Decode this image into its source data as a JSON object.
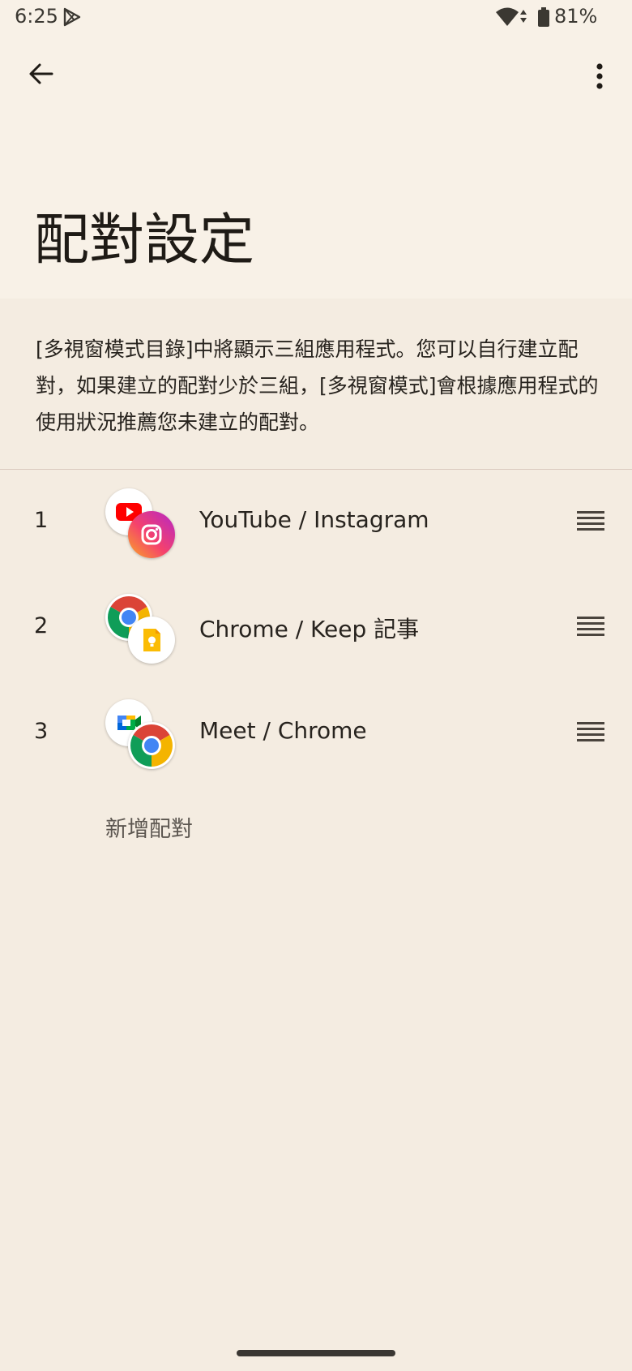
{
  "status": {
    "time": "6:25",
    "battery": "81%"
  },
  "page": {
    "title": "配對設定",
    "description": "[多視窗模式目錄]中將顯示三組應用程式。您可以自行建立配對，如果建立的配對少於三組，[多視窗模式]會根據應用程式的使用狀況推薦您未建立的配對。",
    "add_label": "新增配對"
  },
  "pairs": [
    {
      "num": "1",
      "label": "YouTube / Instagram",
      "icons": [
        "youtube-icon",
        "instagram-icon"
      ]
    },
    {
      "num": "2",
      "label": "Chrome / Keep 記事",
      "icons": [
        "chrome-icon",
        "keep-icon"
      ]
    },
    {
      "num": "3",
      "label": "Meet / Chrome",
      "icons": [
        "meet-icon",
        "chrome-icon"
      ]
    }
  ]
}
